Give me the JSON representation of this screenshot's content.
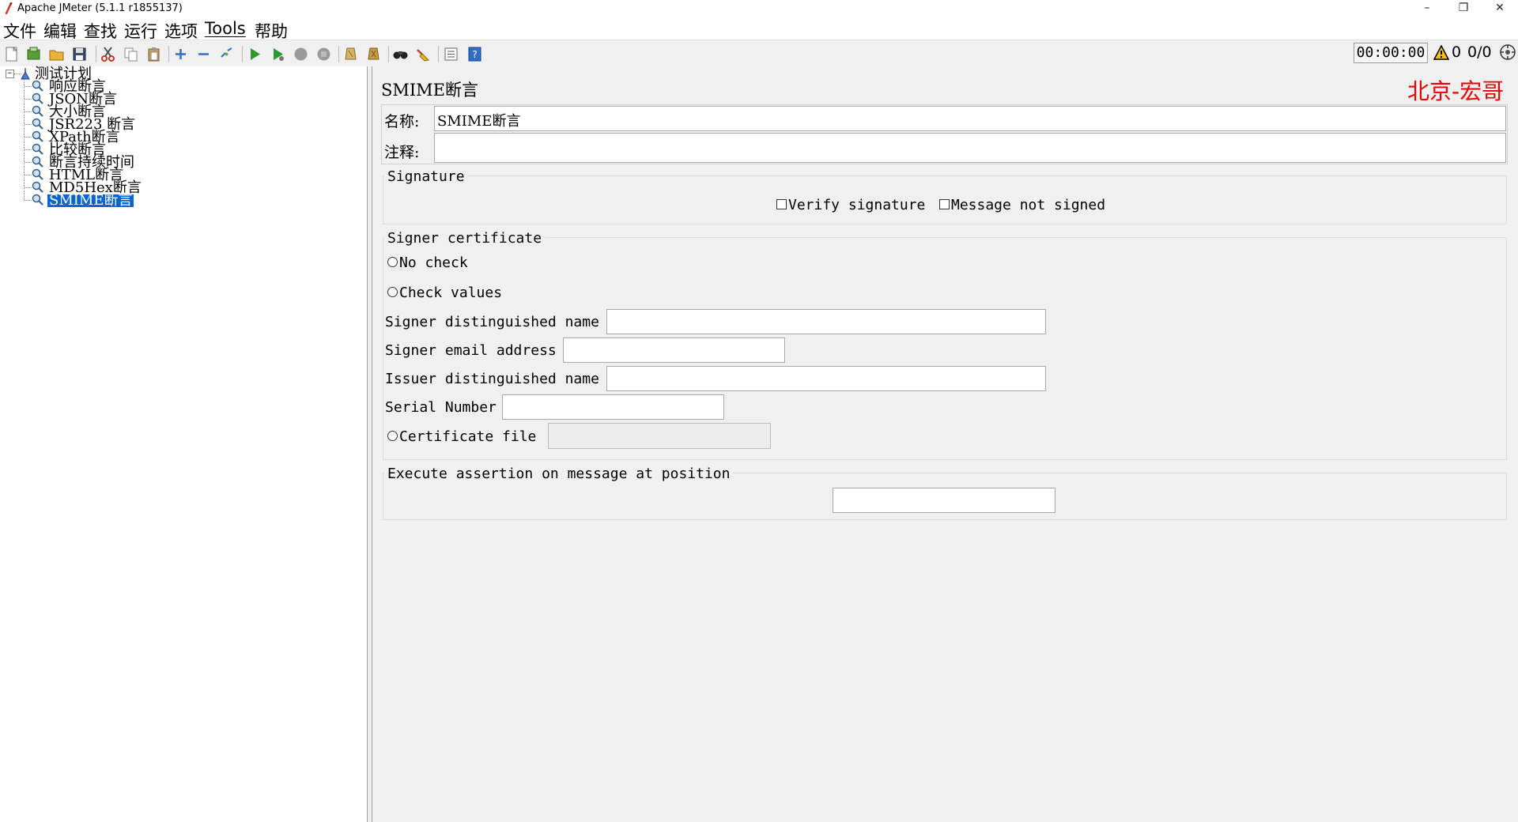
{
  "window": {
    "title": "Apache JMeter (5.1.1 r1855137)",
    "minimize": "–",
    "restore": "❐",
    "close": "✕"
  },
  "menu": [
    "文件",
    "编辑",
    "查找",
    "运行",
    "选项",
    "Tools",
    "帮助"
  ],
  "toolbar": {
    "icons": [
      "new-icon",
      "templates-icon",
      "open-icon",
      "save-icon",
      "cut-icon",
      "copy-icon",
      "paste-icon",
      "expand-icon",
      "collapse-icon",
      "toggle-icon",
      "start-icon",
      "start-no-pause-icon",
      "stop-icon",
      "shutdown-icon",
      "clear-icon",
      "clear-all-icon",
      "search-icon",
      "reset-search-icon",
      "function-helper-icon",
      "help-icon"
    ],
    "timer": "00:00:00",
    "warning_count": "0",
    "threads": "0/0"
  },
  "tree": {
    "root": "测试计划",
    "children": [
      "响应断言",
      "JSON断言",
      "大小断言",
      "JSR223 断言",
      "XPath断言",
      "比较断言",
      "断言持续时间",
      "HTML断言",
      "MD5Hex断言",
      "SMIME断言"
    ],
    "selected_index": 9
  },
  "panel": {
    "title": "SMIME断言",
    "watermark": "北京-宏哥",
    "name_label": "名称:",
    "name_value": "SMIME断言",
    "comment_label": "注释:",
    "comment_value": "",
    "signature": {
      "title": "Signature",
      "verify_label": "Verify signature",
      "not_signed_label": "Message not signed"
    },
    "signer": {
      "title": "Signer certificate",
      "no_check": "No check",
      "check_values": "Check values",
      "dn_label": "Signer distinguished name",
      "dn_value": "",
      "email_label": "Signer email address",
      "email_value": "",
      "issuer_label": "Issuer distinguished name",
      "issuer_value": "",
      "serial_label": "Serial Number",
      "serial_value": "",
      "cert_file_label": "Certificate file",
      "cert_file_value": ""
    },
    "execute": {
      "title": "Execute assertion on message at position",
      "value": ""
    }
  }
}
